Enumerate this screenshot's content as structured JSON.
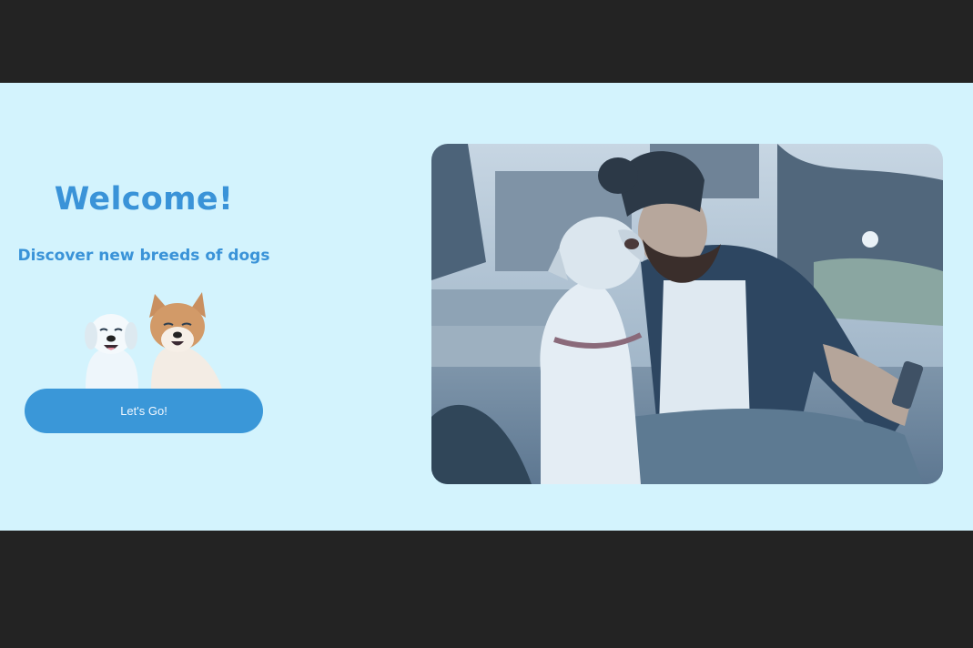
{
  "welcome": {
    "title": "Welcome!",
    "subtitle": "Discover new breeds of dogs"
  },
  "cta": {
    "label": "Let's Go!"
  },
  "images": {
    "dogs_illustration": "two-smiling-dogs",
    "hero_photo": "man-hugging-bulldog-selfie"
  },
  "colors": {
    "background": "#d3f3fd",
    "accent": "#3a93d8",
    "letterbox": "#232323"
  }
}
